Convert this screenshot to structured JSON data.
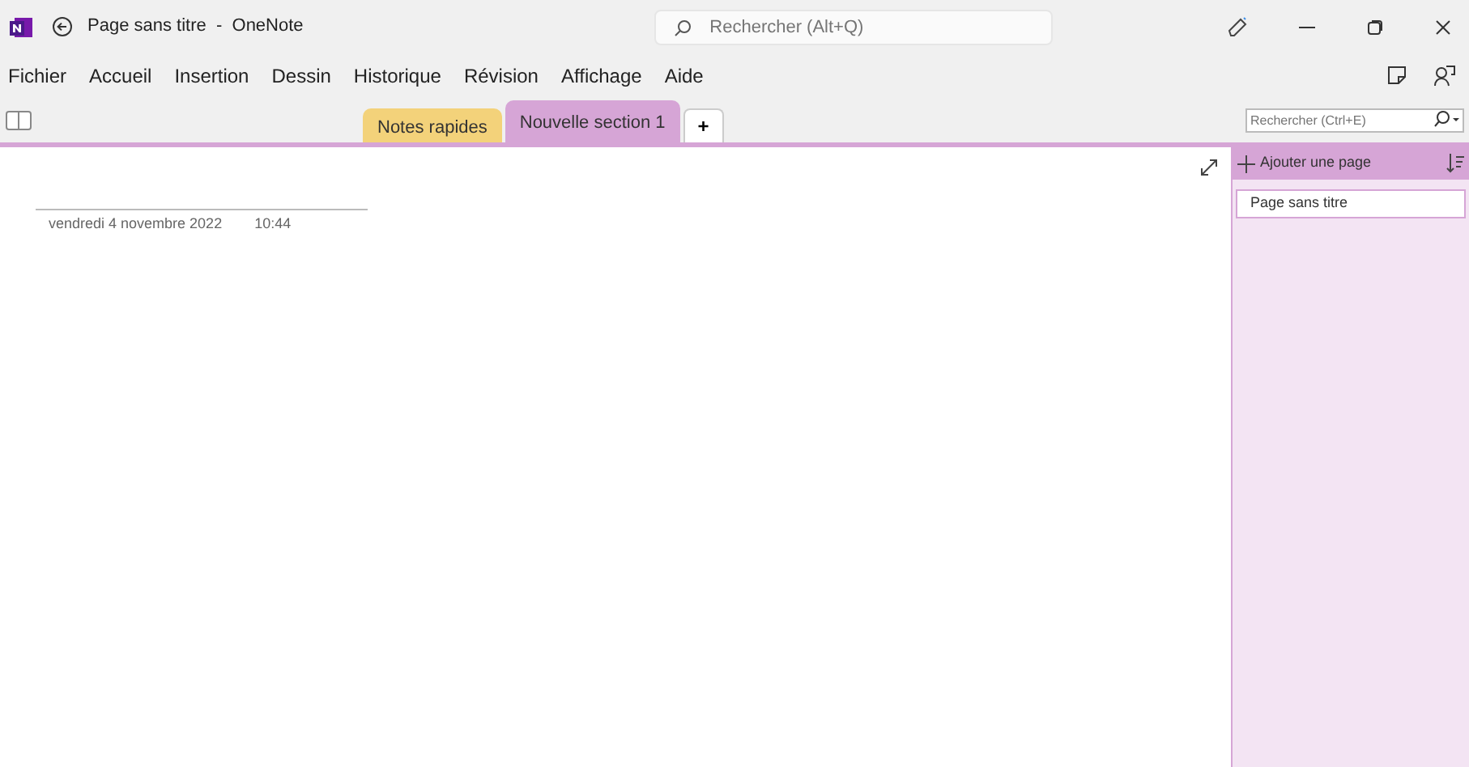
{
  "window": {
    "title": "Page sans titre",
    "app_name": "OneNote",
    "separator": "-"
  },
  "title_search": {
    "placeholder": "Rechercher (Alt+Q)"
  },
  "menu": [
    "Fichier",
    "Accueil",
    "Insertion",
    "Dessin",
    "Historique",
    "Révision",
    "Affichage",
    "Aide"
  ],
  "sections": [
    {
      "label": "Notes rapides",
      "selected": false,
      "color": "#f3d27a"
    },
    {
      "label": "Nouvelle section 1",
      "selected": true,
      "color": "#d6a5d6"
    }
  ],
  "add_section": "+",
  "notebook_search": {
    "placeholder": "Rechercher (Ctrl+E)"
  },
  "page_list": {
    "add_page": "Ajouter une page",
    "pages": [
      {
        "title": "Page sans titre",
        "selected": true
      }
    ]
  },
  "page": {
    "date": "vendredi 4 novembre 2022",
    "time": "10:44"
  }
}
